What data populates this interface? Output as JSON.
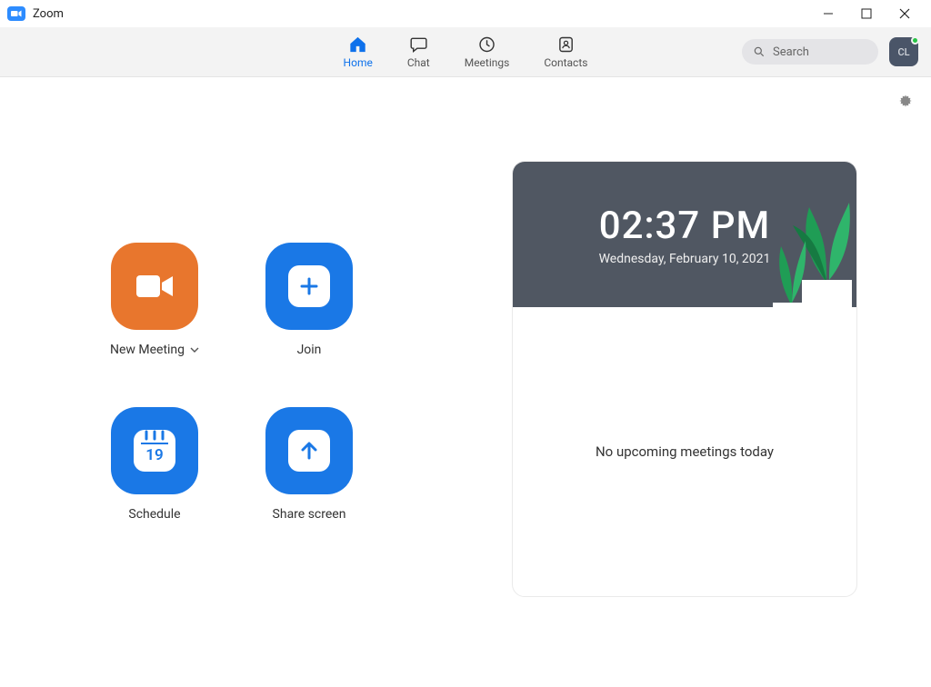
{
  "titlebar": {
    "title": "Zoom"
  },
  "nav": {
    "tabs": {
      "home": "Home",
      "chat": "Chat",
      "meetings": "Meetings",
      "contacts": "Contacts"
    },
    "search_placeholder": "Search",
    "avatar_initials": "CL"
  },
  "actions": {
    "new_meeting": "New Meeting",
    "join": "Join",
    "schedule": "Schedule",
    "share_screen": "Share screen",
    "calendar_day": "19"
  },
  "panel": {
    "time": "02:37 PM",
    "date": "Wednesday, February 10, 2021",
    "empty_message": "No upcoming meetings today"
  },
  "colors": {
    "accent_blue": "#0E71EB",
    "tile_blue": "#1A78E6",
    "tile_orange": "#E8762D",
    "header_gray": "#505762"
  }
}
